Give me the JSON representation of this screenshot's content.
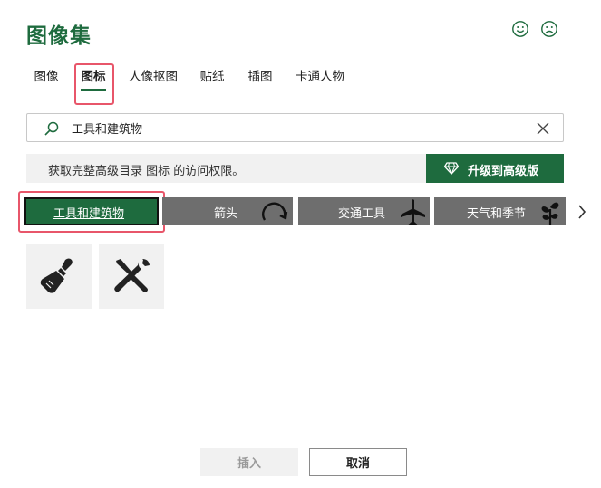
{
  "dialog": {
    "title": "图像集"
  },
  "feedback": {
    "happy_icon": "smile-face-icon",
    "sad_icon": "frown-face-icon"
  },
  "tabs": [
    {
      "label": "图像",
      "active": false
    },
    {
      "label": "图标",
      "active": true
    },
    {
      "label": "人像抠图",
      "active": false
    },
    {
      "label": "贴纸",
      "active": false
    },
    {
      "label": "插图",
      "active": false
    },
    {
      "label": "卡通人物",
      "active": false
    }
  ],
  "search": {
    "value": "工具和建筑物",
    "placeholder": "",
    "icon": "search-icon",
    "clear_icon": "close-icon"
  },
  "banner": {
    "text": "获取完整高级目录 图标 的访问权限。",
    "upgrade_label": "升级到高级版",
    "upgrade_icon": "diamond-icon"
  },
  "categories": [
    {
      "label": "工具和建筑物",
      "selected": true,
      "icon": ""
    },
    {
      "label": "箭头",
      "selected": false,
      "icon": "circular-arrow-icon"
    },
    {
      "label": "交通工具",
      "selected": false,
      "icon": "airplane-icon"
    },
    {
      "label": "天气和季节",
      "selected": false,
      "icon": "plant-sprout-icon"
    }
  ],
  "results": [
    {
      "icon": "paintbrush-icon"
    },
    {
      "icon": "wrench-screwdriver-icon"
    }
  ],
  "actions": {
    "insert_label": "插入",
    "insert_enabled": false,
    "cancel_label": "取消"
  },
  "colors": {
    "accent": "#1e6b3e",
    "highlight": "#e8566a",
    "category_bg": "#6e6e6e",
    "tile_bg": "#f1f1f1"
  }
}
